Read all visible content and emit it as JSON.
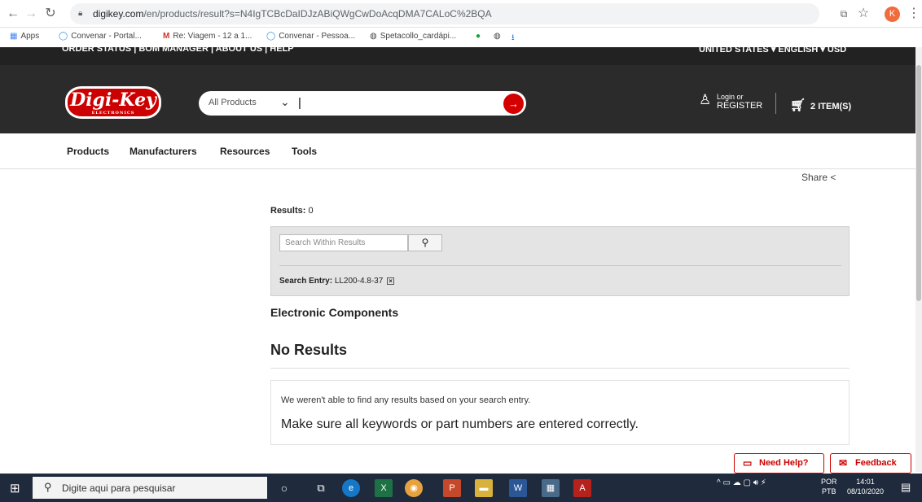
{
  "browser": {
    "url_host": "digikey.com",
    "url_path": "/en/products/result?s=N4IgTCBcDaIDJzABiQWgCwDoAcqDMA7CALoC%2BQA",
    "bookmarks": [
      "Apps",
      "Convenar - Portal...",
      "Re: Viagem - 12 a 1...",
      "Convenar - Pessoa...",
      "Spetacollo_cardápi..."
    ],
    "profile_initial": "K"
  },
  "site": {
    "top_links": "ORDER STATUS  |  BOM MANAGER  |  ABOUT US  |  HELP",
    "region": "UNITED STATES ▾  ENGLISH ▾  USD",
    "logo_text": "Digi-Key",
    "logo_sub": "ELECTRONICS",
    "search_category": "All Products",
    "login_small": "Login or",
    "login_big": "REGISTER",
    "cart": "2 ITEM(S)",
    "nav": [
      "Products",
      "Manufacturers",
      "Resources",
      "Tools"
    ],
    "share": "Share"
  },
  "results": {
    "label": "Results:",
    "count": "0",
    "within_placeholder": "Search Within Results",
    "entry_label": "Search Entry:",
    "entry_value": "LL200-4.8-37",
    "section_title": "Electronic Components",
    "no_results_title": "No Results",
    "message_small": "We weren't able to find any results based on your search entry.",
    "message_large": "Make sure all keywords or part numbers are entered correctly.",
    "need_help": "Need Help?",
    "feedback": "Feedback"
  },
  "taskbar": {
    "search_placeholder": "Digite aqui para pesquisar",
    "lang_top": "POR",
    "lang_bottom": "PTB",
    "time": "14:01",
    "date": "08/10/2020"
  },
  "colors": {
    "brand_red": "#cc0000",
    "header_dark": "#2b2b2b",
    "taskbar": "#1f2a3c"
  }
}
